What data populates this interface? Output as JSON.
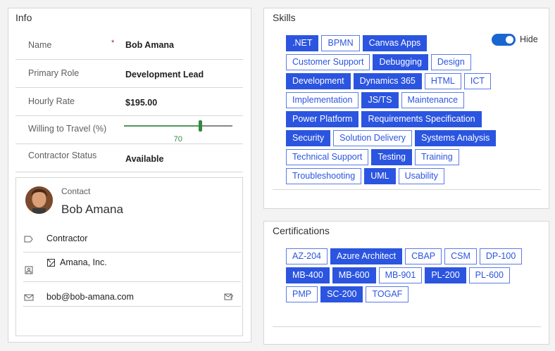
{
  "info": {
    "title": "Info",
    "fields": [
      {
        "label": "Name",
        "value": "Bob Amana",
        "required": "*"
      },
      {
        "label": "Primary Role",
        "value": "Development Lead"
      },
      {
        "label": "Hourly Rate",
        "value": "$195.00"
      },
      {
        "label": "Willing to Travel (%)",
        "value": 70
      },
      {
        "label": "Contractor Status",
        "value": "Available"
      }
    ],
    "contact": {
      "subtitle": "Contact",
      "name": "Bob Amana",
      "type": "Contractor",
      "company": "Amana, Inc.",
      "email": "bob@bob-amana.com"
    }
  },
  "skills": {
    "title": "Skills",
    "toggle_label": "Hide",
    "toggle_on": true,
    "tags": [
      {
        "label": ".NET",
        "selected": true
      },
      {
        "label": "BPMN",
        "selected": false
      },
      {
        "label": "Canvas Apps",
        "selected": true
      },
      {
        "label": "Customer Support",
        "selected": false
      },
      {
        "label": "Debugging",
        "selected": true
      },
      {
        "label": "Design",
        "selected": false
      },
      {
        "label": "Development",
        "selected": true
      },
      {
        "label": "Dynamics 365",
        "selected": true
      },
      {
        "label": "HTML",
        "selected": false
      },
      {
        "label": "ICT",
        "selected": false
      },
      {
        "label": "Implementation",
        "selected": false
      },
      {
        "label": "JS/TS",
        "selected": true
      },
      {
        "label": "Maintenance",
        "selected": false
      },
      {
        "label": "Power Platform",
        "selected": true
      },
      {
        "label": "Requirements Specification",
        "selected": true
      },
      {
        "label": "Security",
        "selected": true
      },
      {
        "label": "Solution Delivery",
        "selected": false
      },
      {
        "label": "Systems Analysis",
        "selected": true
      },
      {
        "label": "Technical Support",
        "selected": false
      },
      {
        "label": "Testing",
        "selected": true
      },
      {
        "label": "Training",
        "selected": false
      },
      {
        "label": "Troubleshooting",
        "selected": false
      },
      {
        "label": "UML",
        "selected": true
      },
      {
        "label": "Usability",
        "selected": false
      }
    ]
  },
  "certifications": {
    "title": "Certifications",
    "tags": [
      {
        "label": "AZ-204",
        "selected": false
      },
      {
        "label": "Azure Architect",
        "selected": true
      },
      {
        "label": "CBAP",
        "selected": false
      },
      {
        "label": "CSM",
        "selected": false
      },
      {
        "label": "DP-100",
        "selected": false
      },
      {
        "label": "MB-400",
        "selected": true
      },
      {
        "label": "MB-600",
        "selected": true
      },
      {
        "label": "MB-901",
        "selected": false
      },
      {
        "label": "PL-200",
        "selected": true
      },
      {
        "label": "PL-600",
        "selected": false
      },
      {
        "label": "PMP",
        "selected": false
      },
      {
        "label": "SC-200",
        "selected": true
      },
      {
        "label": "TOGAF",
        "selected": false
      }
    ]
  },
  "colors": {
    "accent": "#2b55e0",
    "slider": "#2f8a40",
    "toggle": "#1a66d0"
  }
}
